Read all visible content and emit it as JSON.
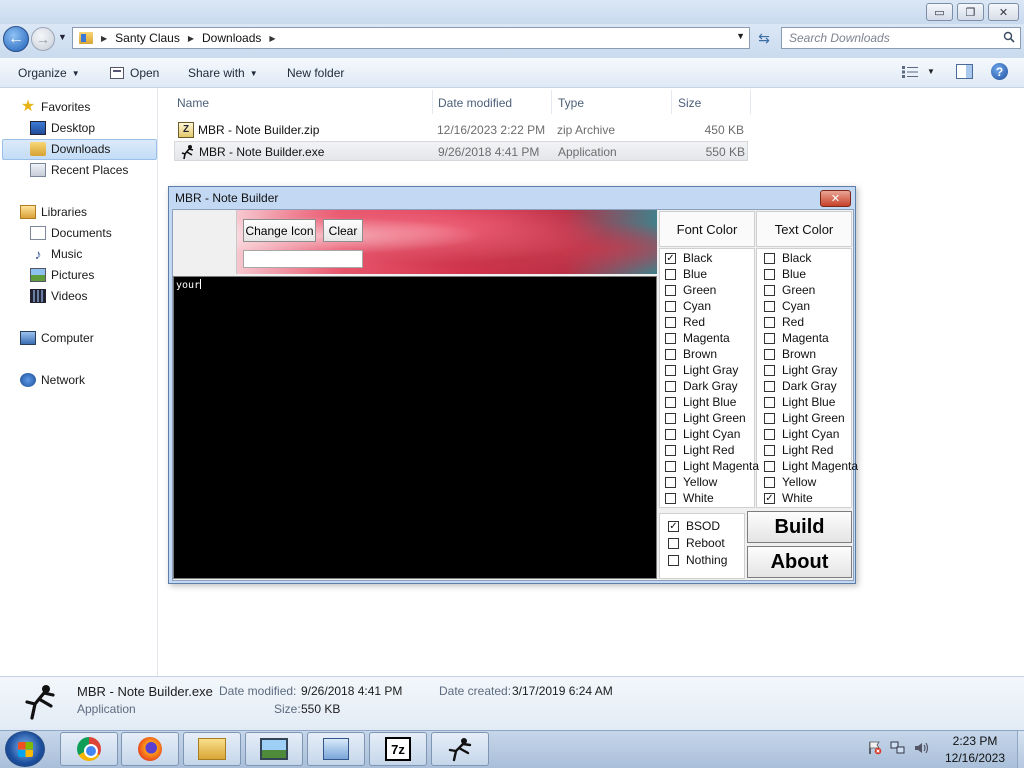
{
  "explorer": {
    "window_buttons": {
      "minimize": "▭",
      "maximize": "❐",
      "close": "✕"
    },
    "breadcrumb": [
      "Santy Claus",
      "Downloads"
    ],
    "search_placeholder": "Search Downloads",
    "toolbar": {
      "organize": "Organize",
      "open": "Open",
      "share_with": "Share with",
      "new_folder": "New folder"
    },
    "nav": {
      "favorites": "Favorites",
      "desktop": "Desktop",
      "downloads": "Downloads",
      "recent_places": "Recent Places",
      "libraries": "Libraries",
      "documents": "Documents",
      "music": "Music",
      "pictures": "Pictures",
      "videos": "Videos",
      "computer": "Computer",
      "network": "Network"
    },
    "columns": {
      "name": "Name",
      "date": "Date modified",
      "type": "Type",
      "size": "Size"
    },
    "files": [
      {
        "name": "MBR - Note Builder.zip",
        "date": "12/16/2023 2:22 PM",
        "type": "zip Archive",
        "size": "450 KB",
        "icon": "zip-archive-icon"
      },
      {
        "name": "MBR - Note Builder.exe",
        "date": "9/26/2018 4:41 PM",
        "type": "Application",
        "size": "550 KB",
        "icon": "application-icon"
      }
    ],
    "details": {
      "filename": "MBR - Note Builder.exe",
      "filetype": "Application",
      "date_modified_label": "Date modified:",
      "date_modified": "9/26/2018 4:41 PM",
      "size_label": "Size:",
      "size": "550 KB",
      "date_created_label": "Date created:",
      "date_created": "3/17/2019 6:24 AM"
    }
  },
  "mbr": {
    "title": "MBR - Note Builder",
    "close": "✕",
    "change_icon": "Change Icon",
    "clear": "Clear",
    "icon_path": "",
    "note_text": "your",
    "font_color_header": "Font Color",
    "text_color_header": "Text Color",
    "colors": [
      "Black",
      "Blue",
      "Green",
      "Cyan",
      "Red",
      "Magenta",
      "Brown",
      "Light Gray",
      "Dark Gray",
      "Light Blue",
      "Light Green",
      "Light Cyan",
      "Light Red",
      "Light Magenta",
      "Yellow",
      "White"
    ],
    "font_color_checked": "Black",
    "text_color_checked": "White",
    "actions": [
      "BSOD",
      "Reboot",
      "Nothing"
    ],
    "action_checked": "BSOD",
    "build": "Build",
    "about": "About"
  },
  "taskbar": {
    "apps": [
      "chrome-icon",
      "firefox-icon",
      "windows-explorer-icon",
      "photo-viewer-icon",
      "control-panel-icon",
      "7zip-icon",
      "mbr-note-builder-icon"
    ],
    "seven_zip_label": "7z",
    "time": "2:23 PM",
    "date": "12/16/2023"
  },
  "colors": {
    "titlebar": "#dbe7f5",
    "selection": "#c3dcf6",
    "dialog_frame": "#c3d9f3",
    "note_bg": "#000000",
    "note_fg": "#ffffff",
    "close_red": "#c6412a"
  }
}
